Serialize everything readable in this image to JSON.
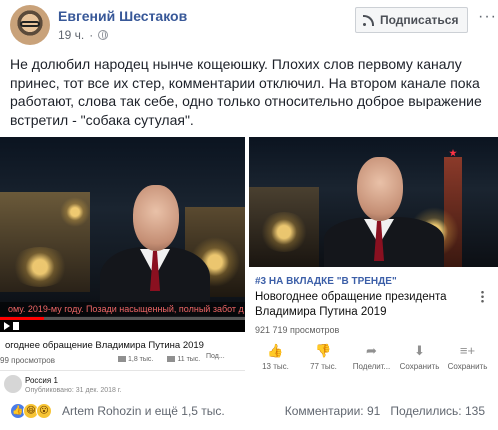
{
  "post": {
    "author": "Евгений Шестаков",
    "time": "19 ч.",
    "subscribe_label": "Подписаться",
    "more_label": "···",
    "text": "Не долюбил народец нынче кощеюшку. Плохих слов первому каналу принес, тот все их стер, комментарии отключил. На втором канале пока работают, слова так себе, одно только относительно доброе выражение встретил - \"собака сутулая\"."
  },
  "left_video": {
    "ticker": "ому. 2019-му году. Позади насыщенный, полный забот д",
    "progress": 0.18,
    "title": "огоднее обращение Владимира Путина 2019",
    "views": "99 просмотров",
    "likes": "1,8 тыс.",
    "dislikes": "11 тыс.",
    "share": "Под...",
    "channel": "Россия 1",
    "channel_date": "Опубликовано: 31 дек. 2018 г."
  },
  "right_video": {
    "trend": "#3 НА ВКЛАДКЕ \"В ТРЕНДЕ\"",
    "title": "Новогоднее обращение президента Владимира Путина 2019",
    "views": "921 719 просмотров",
    "actions": [
      {
        "icon": "thumb-up-icon",
        "glyph": "👍",
        "label": "13 тыс."
      },
      {
        "icon": "thumb-down-icon",
        "glyph": "👎",
        "label": "77 тыс."
      },
      {
        "icon": "share-icon",
        "glyph": "➦",
        "label": "Поделит..."
      },
      {
        "icon": "download-icon",
        "glyph": "⬇",
        "label": "Сохранить"
      },
      {
        "icon": "playlist-add-icon",
        "glyph": "≡+",
        "label": "Сохранить"
      }
    ]
  },
  "footer": {
    "reactions_text": "Artem Rohozin и ещё 1,5 тыс.",
    "comments": "Комментарии: 91",
    "shares": "Поделились: 135"
  }
}
